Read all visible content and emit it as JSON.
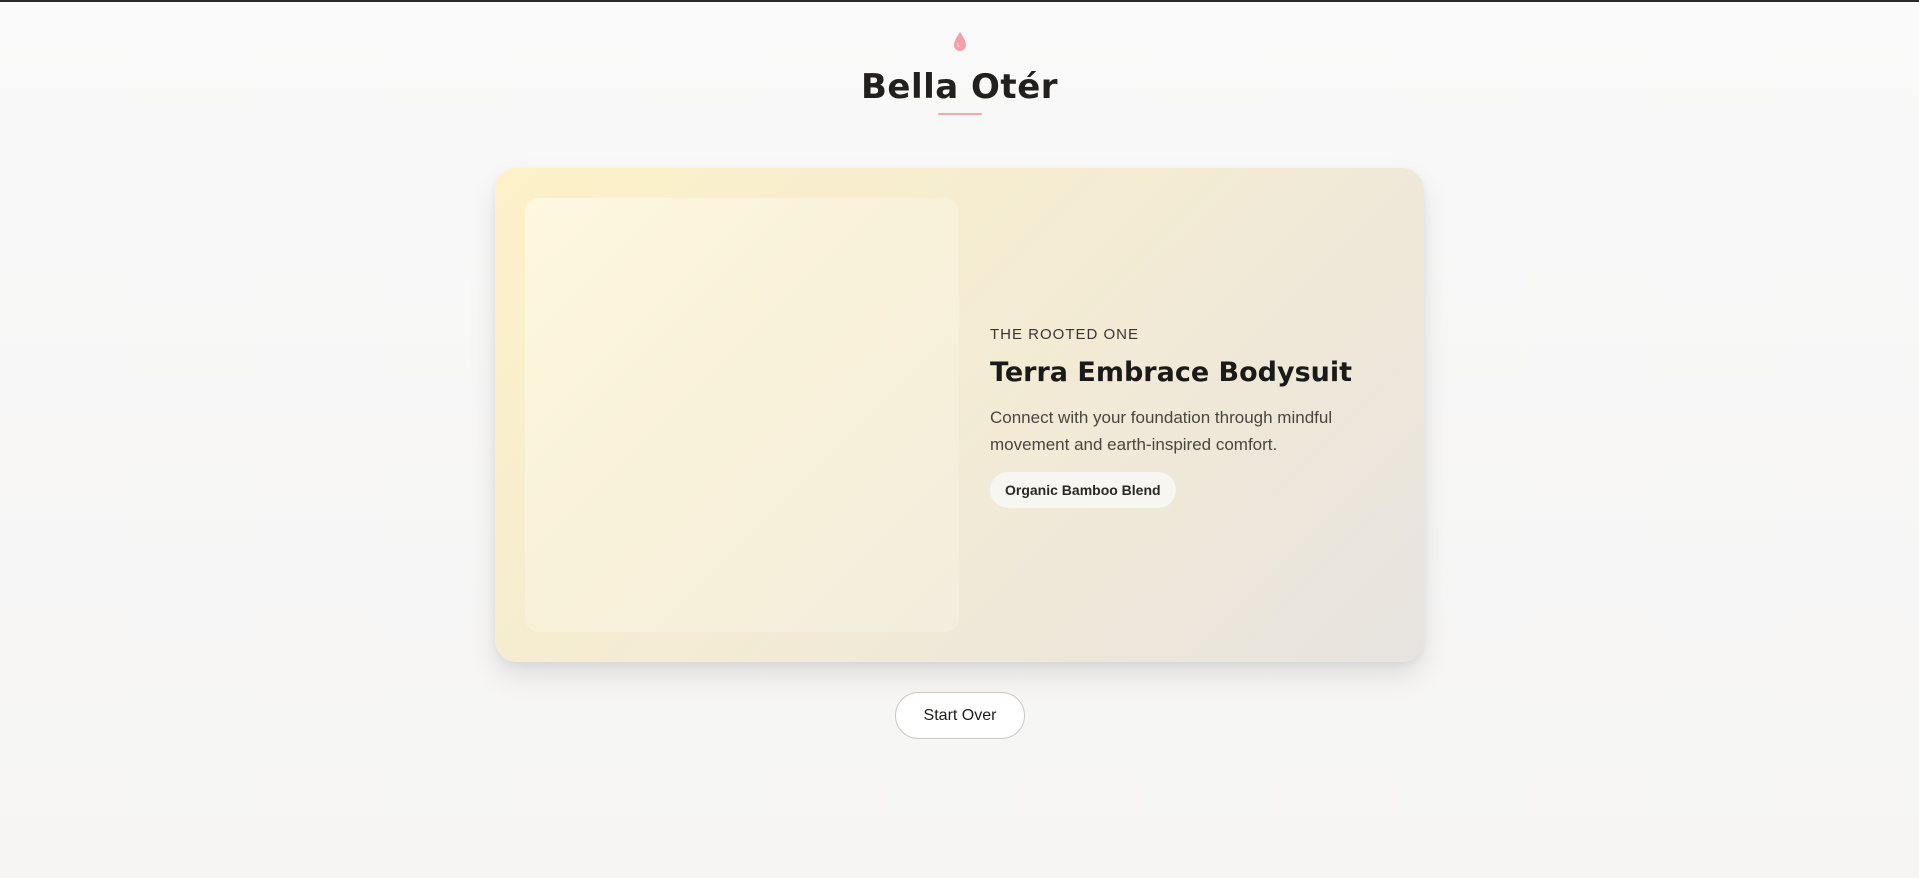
{
  "brand": {
    "name": "Bella Otér",
    "icon": "drop-icon",
    "accent_color": "#f2a6ad"
  },
  "result": {
    "eyebrow": "THE ROOTED ONE",
    "product_name": "Terra Embrace Bodysuit",
    "description": "Connect with your foundation through mindful movement and earth-inspired comfort.",
    "material": "Organic Bamboo Blend",
    "card_gradient": [
      "#fdf1c7",
      "#e7e4e0"
    ]
  },
  "actions": {
    "start_over_label": "Start Over"
  }
}
